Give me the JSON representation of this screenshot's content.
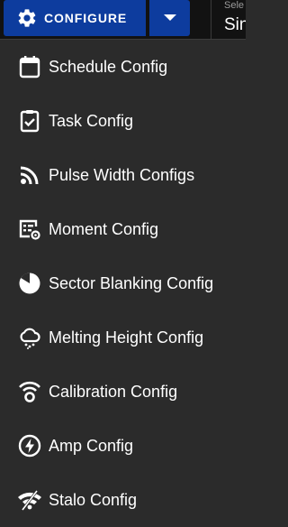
{
  "toolbar": {
    "configure_label": "CONFIGURE",
    "configure_icon": "gear-icon",
    "dropdown_icon": "caret-down-icon",
    "select_label_partial": "Sele",
    "select_value_partial": "Sin",
    "accent_color": "#0d3c9e"
  },
  "menu": {
    "items": [
      {
        "label": "Schedule Config",
        "icon": "calendar-icon"
      },
      {
        "label": "Task Config",
        "icon": "task-checklist-icon"
      },
      {
        "label": "Pulse Width Configs",
        "icon": "rss-feed-icon"
      },
      {
        "label": "Moment Config",
        "icon": "moment-settings-icon"
      },
      {
        "label": "Sector Blanking Config",
        "icon": "pie-sector-icon"
      },
      {
        "label": "Melting Height Config",
        "icon": "cloud-snow-icon"
      },
      {
        "label": "Calibration Config",
        "icon": "wifi-tower-icon"
      },
      {
        "label": "Amp Config",
        "icon": "lightning-circle-icon"
      },
      {
        "label": "Stalo Config",
        "icon": "wifi-off-icon"
      }
    ]
  }
}
